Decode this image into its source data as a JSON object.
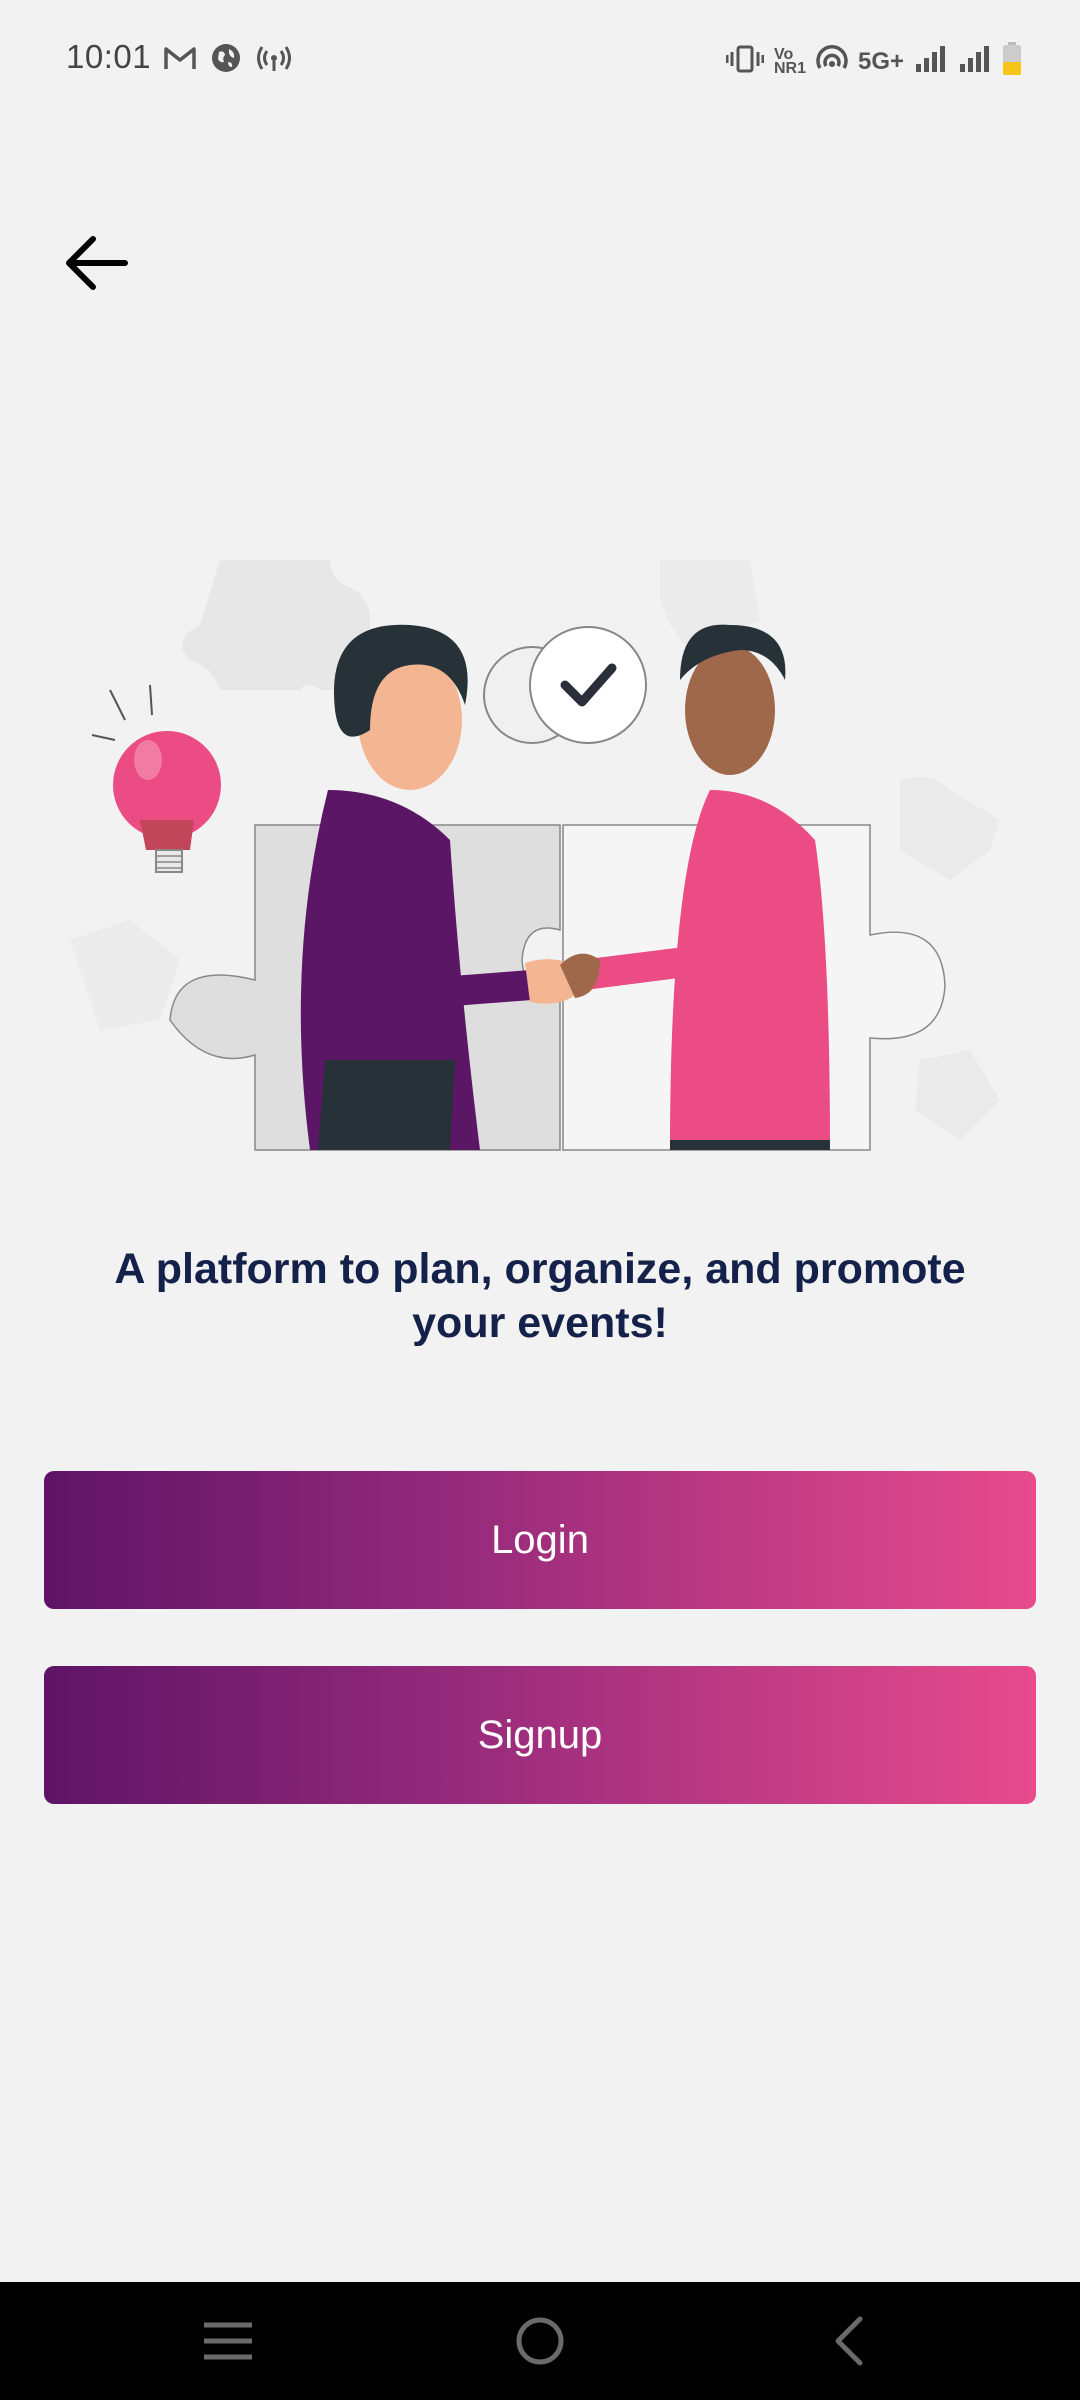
{
  "status_bar": {
    "time": "10:01",
    "left_icons": [
      "gmail-icon",
      "globe-icon",
      "hotspot-icon"
    ],
    "right_icons": [
      "vibrate-icon",
      "volte-icon",
      "wifi-calling-icon",
      "network-5g-icon",
      "signal-icon",
      "signal-icon",
      "battery-icon"
    ],
    "vo_label": "Vo",
    "nr_label": "NR1",
    "network_label": "5G+",
    "battery_color": "#f5c518"
  },
  "header": {
    "back_icon": "arrow-left-icon"
  },
  "hero": {
    "illustration": "handshake-puzzle-illustration",
    "tagline": "A platform to plan, organize, and promote your events!"
  },
  "actions": {
    "login_label": "Login",
    "signup_label": "Signup"
  },
  "colors": {
    "background": "#f2f2f2",
    "gradient_start": "#5e1466",
    "gradient_end": "#e84b8c",
    "tagline": "#14214a"
  },
  "nav_bar": {
    "recents_icon": "menu-icon",
    "home_icon": "home-circle-icon",
    "back_icon": "nav-back-icon"
  }
}
